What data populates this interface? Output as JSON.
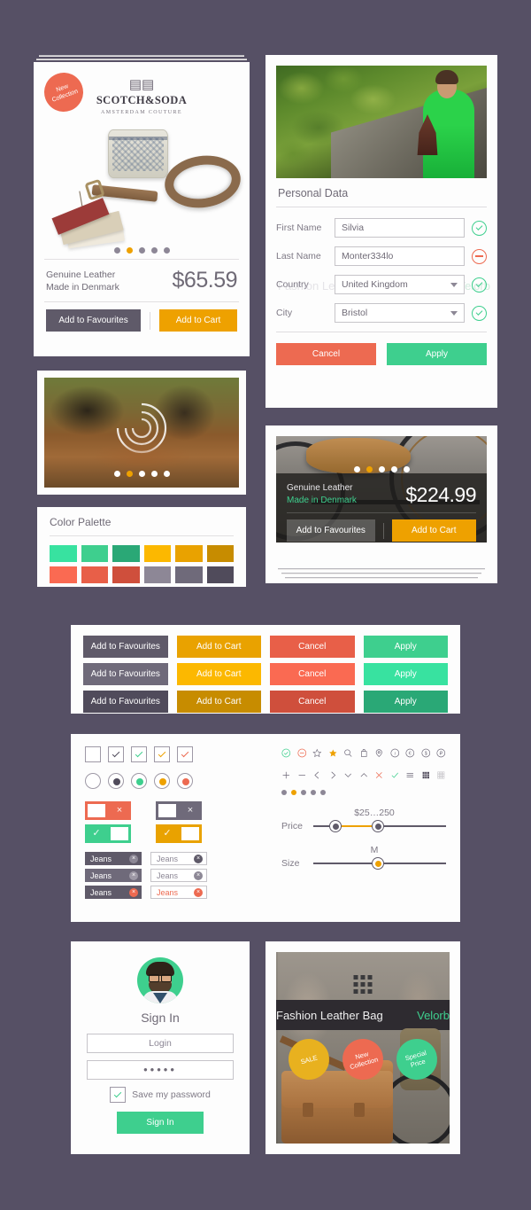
{
  "theme": {
    "background": "#565065",
    "accent_green": "#3ecf8e",
    "accent_orange": "#eea100",
    "accent_red": "#ed6a51",
    "accent_gray": "#5f5a69"
  },
  "product_card": {
    "badge": {
      "line1": "New",
      "line2": "Collection"
    },
    "brand": {
      "name": "SCOTCH&SODA",
      "registered": "®",
      "sub": "AMSTERDAM COUTURE",
      "machine_icon": "sewing-machine-icon"
    },
    "carousel": {
      "count": 5,
      "active_index": 1
    },
    "desc_line1": "Genuine Leather",
    "desc_line2": "Made in Denmark",
    "price": "$65.59",
    "btn_favourites": "Add to Favourites",
    "btn_cart": "Add to Cart"
  },
  "loader_card": {
    "spinner": "spiral-loader-icon",
    "carousel": {
      "count": 5,
      "active_index": 1
    }
  },
  "palette_card": {
    "title": "Color Palette",
    "row1": [
      "#38e2a0",
      "#3ecf8e",
      "#2aa876",
      "#fcb800",
      "#e9a200",
      "#c78c00"
    ],
    "row2": [
      "#fa6a52",
      "#e85f48",
      "#cf4f3c",
      "#8d8796",
      "#6f6a7a",
      "#504b5b"
    ]
  },
  "form_card": {
    "photo_alt": "woman-in-green-dress-photo",
    "title": "Personal Data",
    "ghost_watermark": {
      "left": "Fashion Leather Bag",
      "right": "Velorb"
    },
    "fields": [
      {
        "label": "First Name",
        "value": "Silvia",
        "type": "text",
        "status": "ok"
      },
      {
        "label": "Last Name",
        "value": "Monter334lo",
        "type": "text",
        "status": "error"
      },
      {
        "label": "Country",
        "value": "United Kingdom",
        "type": "select",
        "status": "ok"
      },
      {
        "label": "City",
        "value": "Bristol",
        "type": "select",
        "status": "ok"
      }
    ],
    "btn_cancel": "Cancel",
    "btn_apply": "Apply"
  },
  "bike_card": {
    "photo_alt": "bicycle-with-leather-saddle-photo",
    "carousel": {
      "count": 5,
      "active_index": 1
    },
    "desc_line1": "Genuine Leather",
    "desc_line2": "Made in Denmark",
    "price": "$224.99",
    "btn_favourites": "Add to Favourites",
    "btn_cart": "Add to Cart"
  },
  "buttons_card": {
    "labels": [
      "Add to Favourites",
      "Add to Cart",
      "Cancel",
      "Apply"
    ],
    "states": [
      {
        "name": "normal",
        "colors": [
          "#5f5a69",
          "#e9a200",
          "#e85f48",
          "#3ecf8e"
        ]
      },
      {
        "name": "hover",
        "colors": [
          "#6f6a7a",
          "#fcb800",
          "#fa6a52",
          "#38e2a0"
        ]
      },
      {
        "name": "active",
        "colors": [
          "#504b5b",
          "#c78c00",
          "#cf4f3c",
          "#2aa876"
        ]
      }
    ]
  },
  "controls_card": {
    "checkboxes": [
      {
        "state": "unchecked",
        "color": ""
      },
      {
        "state": "checked",
        "color": "#504b5b"
      },
      {
        "state": "checked",
        "color": "#3ecf8e"
      },
      {
        "state": "checked",
        "color": "#eea100"
      },
      {
        "state": "checked",
        "color": "#ed6a51"
      }
    ],
    "radios": [
      {
        "state": "unselected",
        "color": ""
      },
      {
        "state": "selected",
        "color": "#504b5b"
      },
      {
        "state": "selected",
        "color": "#3ecf8e"
      },
      {
        "state": "selected",
        "color": "#eea100"
      },
      {
        "state": "selected",
        "color": "#ed6a51"
      }
    ],
    "toggles": [
      {
        "state": "off",
        "color": "#ed6a51",
        "mark": "×"
      },
      {
        "state": "off",
        "color": "#6f6a7a",
        "mark": "×"
      },
      {
        "state": "on",
        "color": "#3ecf8e",
        "mark": "✓"
      },
      {
        "state": "on",
        "color": "#e9a200",
        "mark": "✓"
      }
    ],
    "tags": {
      "label": "Jeans",
      "rows": [
        {
          "filled_close": "#5f5a69",
          "outline_close": "#5f5a69",
          "text_color": ""
        },
        {
          "filled_close": "#8d8896",
          "outline_close": "#8d8896",
          "text_color": ""
        },
        {
          "filled_close": "#ed6a51",
          "outline_close": "#ed6a51",
          "text_color": "#ed6a51"
        }
      ]
    },
    "icons_row1": [
      "check-circle-icon",
      "minus-circle-icon",
      "star-outline-icon",
      "star-filled-icon",
      "search-icon",
      "shopping-bag-icon",
      "location-pin-icon",
      "info-circle-icon",
      "euro-circle-icon",
      "dollar-circle-icon",
      "ruble-circle-icon"
    ],
    "icons_row2": [
      "plus-icon",
      "minus-icon",
      "chevron-left-icon",
      "chevron-right-icon",
      "chevron-down-icon",
      "chevron-up-icon",
      "close-x-icon",
      "check-icon",
      "list-view-icon",
      "grid-view-filled-icon",
      "grid-view-outline-icon"
    ],
    "mini_carousel": {
      "count": 5,
      "active_index": 1
    },
    "sliders": [
      {
        "label": "Price",
        "value": "$25…250",
        "type": "range",
        "low_pct": 16,
        "high_pct": 48
      },
      {
        "label": "Size",
        "value": "M",
        "type": "single",
        "pct": 48
      }
    ]
  },
  "signin_card": {
    "avatar": "user-avatar-photo",
    "title": "Sign In",
    "login_placeholder": "Login",
    "password_mask": "•••••",
    "save_password_label": "Save my password",
    "save_password_checked": true,
    "btn_signin": "Sign In"
  },
  "bag_card": {
    "photo_alt": "leather-satchel-on-bicycle-photo",
    "grid_icon": "grid-menu-icon",
    "title": "Fashion Leather Bag",
    "brand": "Velorb",
    "badges": [
      {
        "line1": "SALE",
        "line2": "",
        "color": "#e8b11f"
      },
      {
        "line1": "New",
        "line2": "Collection",
        "color": "#ed6a51"
      },
      {
        "line1": "Special",
        "line2": "Price",
        "color": "#3ecf8e"
      }
    ]
  }
}
